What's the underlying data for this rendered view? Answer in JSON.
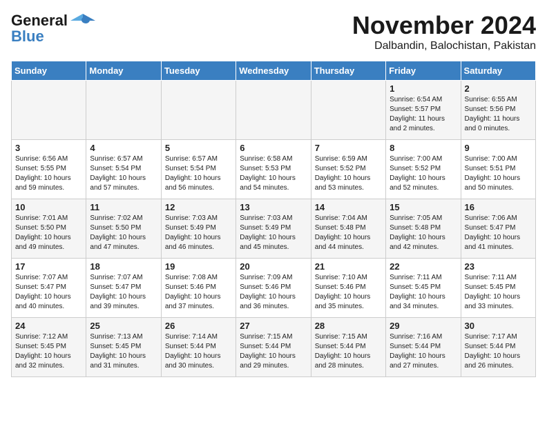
{
  "app": {
    "logo_line1": "General",
    "logo_line2": "Blue"
  },
  "title": "November 2024",
  "subtitle": "Dalbandin, Balochistan, Pakistan",
  "days_of_week": [
    "Sunday",
    "Monday",
    "Tuesday",
    "Wednesday",
    "Thursday",
    "Friday",
    "Saturday"
  ],
  "weeks": [
    [
      {
        "day": "",
        "info": ""
      },
      {
        "day": "",
        "info": ""
      },
      {
        "day": "",
        "info": ""
      },
      {
        "day": "",
        "info": ""
      },
      {
        "day": "",
        "info": ""
      },
      {
        "day": "1",
        "info": "Sunrise: 6:54 AM\nSunset: 5:57 PM\nDaylight: 11 hours and 2 minutes."
      },
      {
        "day": "2",
        "info": "Sunrise: 6:55 AM\nSunset: 5:56 PM\nDaylight: 11 hours and 0 minutes."
      }
    ],
    [
      {
        "day": "3",
        "info": "Sunrise: 6:56 AM\nSunset: 5:55 PM\nDaylight: 10 hours and 59 minutes."
      },
      {
        "day": "4",
        "info": "Sunrise: 6:57 AM\nSunset: 5:54 PM\nDaylight: 10 hours and 57 minutes."
      },
      {
        "day": "5",
        "info": "Sunrise: 6:57 AM\nSunset: 5:54 PM\nDaylight: 10 hours and 56 minutes."
      },
      {
        "day": "6",
        "info": "Sunrise: 6:58 AM\nSunset: 5:53 PM\nDaylight: 10 hours and 54 minutes."
      },
      {
        "day": "7",
        "info": "Sunrise: 6:59 AM\nSunset: 5:52 PM\nDaylight: 10 hours and 53 minutes."
      },
      {
        "day": "8",
        "info": "Sunrise: 7:00 AM\nSunset: 5:52 PM\nDaylight: 10 hours and 52 minutes."
      },
      {
        "day": "9",
        "info": "Sunrise: 7:00 AM\nSunset: 5:51 PM\nDaylight: 10 hours and 50 minutes."
      }
    ],
    [
      {
        "day": "10",
        "info": "Sunrise: 7:01 AM\nSunset: 5:50 PM\nDaylight: 10 hours and 49 minutes."
      },
      {
        "day": "11",
        "info": "Sunrise: 7:02 AM\nSunset: 5:50 PM\nDaylight: 10 hours and 47 minutes."
      },
      {
        "day": "12",
        "info": "Sunrise: 7:03 AM\nSunset: 5:49 PM\nDaylight: 10 hours and 46 minutes."
      },
      {
        "day": "13",
        "info": "Sunrise: 7:03 AM\nSunset: 5:49 PM\nDaylight: 10 hours and 45 minutes."
      },
      {
        "day": "14",
        "info": "Sunrise: 7:04 AM\nSunset: 5:48 PM\nDaylight: 10 hours and 44 minutes."
      },
      {
        "day": "15",
        "info": "Sunrise: 7:05 AM\nSunset: 5:48 PM\nDaylight: 10 hours and 42 minutes."
      },
      {
        "day": "16",
        "info": "Sunrise: 7:06 AM\nSunset: 5:47 PM\nDaylight: 10 hours and 41 minutes."
      }
    ],
    [
      {
        "day": "17",
        "info": "Sunrise: 7:07 AM\nSunset: 5:47 PM\nDaylight: 10 hours and 40 minutes."
      },
      {
        "day": "18",
        "info": "Sunrise: 7:07 AM\nSunset: 5:47 PM\nDaylight: 10 hours and 39 minutes."
      },
      {
        "day": "19",
        "info": "Sunrise: 7:08 AM\nSunset: 5:46 PM\nDaylight: 10 hours and 37 minutes."
      },
      {
        "day": "20",
        "info": "Sunrise: 7:09 AM\nSunset: 5:46 PM\nDaylight: 10 hours and 36 minutes."
      },
      {
        "day": "21",
        "info": "Sunrise: 7:10 AM\nSunset: 5:46 PM\nDaylight: 10 hours and 35 minutes."
      },
      {
        "day": "22",
        "info": "Sunrise: 7:11 AM\nSunset: 5:45 PM\nDaylight: 10 hours and 34 minutes."
      },
      {
        "day": "23",
        "info": "Sunrise: 7:11 AM\nSunset: 5:45 PM\nDaylight: 10 hours and 33 minutes."
      }
    ],
    [
      {
        "day": "24",
        "info": "Sunrise: 7:12 AM\nSunset: 5:45 PM\nDaylight: 10 hours and 32 minutes."
      },
      {
        "day": "25",
        "info": "Sunrise: 7:13 AM\nSunset: 5:45 PM\nDaylight: 10 hours and 31 minutes."
      },
      {
        "day": "26",
        "info": "Sunrise: 7:14 AM\nSunset: 5:44 PM\nDaylight: 10 hours and 30 minutes."
      },
      {
        "day": "27",
        "info": "Sunrise: 7:15 AM\nSunset: 5:44 PM\nDaylight: 10 hours and 29 minutes."
      },
      {
        "day": "28",
        "info": "Sunrise: 7:15 AM\nSunset: 5:44 PM\nDaylight: 10 hours and 28 minutes."
      },
      {
        "day": "29",
        "info": "Sunrise: 7:16 AM\nSunset: 5:44 PM\nDaylight: 10 hours and 27 minutes."
      },
      {
        "day": "30",
        "info": "Sunrise: 7:17 AM\nSunset: 5:44 PM\nDaylight: 10 hours and 26 minutes."
      }
    ]
  ]
}
